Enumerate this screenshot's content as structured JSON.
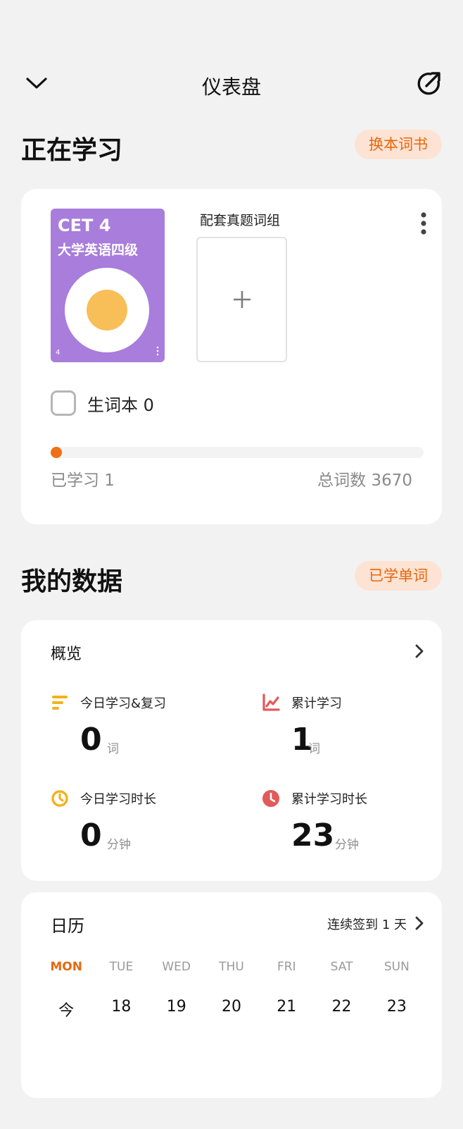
{
  "header": {
    "title": "仪表盘"
  },
  "studying": {
    "section_title": "正在学习",
    "change_book_label": "换本词书",
    "book": {
      "code": "CET 4",
      "name": "大学英语四级",
      "corner_number": "4"
    },
    "group_label": "配套真题词组",
    "add_symbol": "+",
    "wordbook_label": "生词本 0",
    "progress_fraction": 0.0003,
    "learned_text": "已学习 1",
    "total_text": "总词数 3670",
    "colors": {
      "accent": "#f07015",
      "cover": "#a87ddc"
    }
  },
  "data_section": {
    "section_title": "我的数据",
    "learned_words_label": "已学单词",
    "overview": {
      "title": "概览",
      "stats": [
        {
          "label": "今日学习&复习",
          "value": "0",
          "unit": "词",
          "icon": "bars-icon",
          "color": "#f3b21b"
        },
        {
          "label": "累计学习",
          "value": "1",
          "unit": "词",
          "icon": "trend-chart-icon",
          "color": "#e25a5a"
        },
        {
          "label": "今日学习时长",
          "value": "0",
          "unit": "分钟",
          "icon": "timer-icon",
          "color": "#f3b21b"
        },
        {
          "label": "累计学习时长",
          "value": "23",
          "unit": "分钟",
          "icon": "clock-icon",
          "color": "#e25a5a"
        }
      ]
    },
    "calendar": {
      "title": "日历",
      "streak_text": "连续签到 1 天",
      "days": [
        {
          "name": "MON",
          "num": "今",
          "active": true
        },
        {
          "name": "TUE",
          "num": "18"
        },
        {
          "name": "WED",
          "num": "19"
        },
        {
          "name": "THU",
          "num": "20"
        },
        {
          "name": "FRI",
          "num": "21"
        },
        {
          "name": "SAT",
          "num": "22"
        },
        {
          "name": "SUN",
          "num": "23"
        }
      ]
    }
  }
}
